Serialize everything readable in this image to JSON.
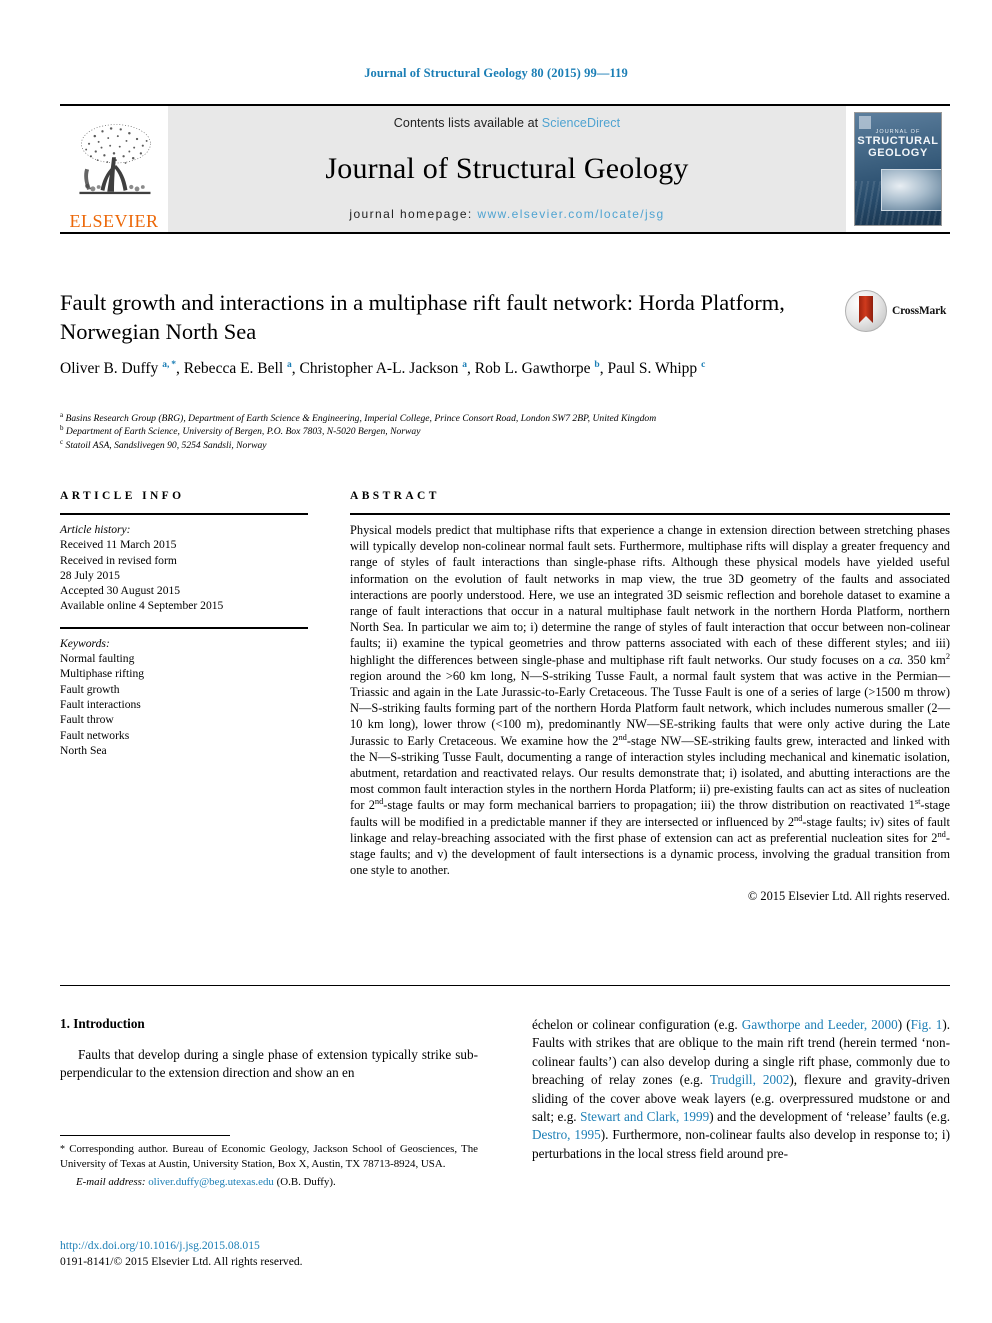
{
  "running_head": "Journal of Structural Geology 80 (2015) 99—119",
  "masthead": {
    "publisher_name": "ELSEVIER",
    "publisher_logo_icon": "elsevier-tree-icon",
    "contents_prefix": "Contents lists available at ",
    "contents_link": "ScienceDirect",
    "journal_name": "Journal of Structural Geology",
    "homepage_prefix": "journal homepage: ",
    "homepage_url": "www.elsevier.com/locate/jsg",
    "cover": {
      "line1": "JOURNAL OF",
      "line2": "STRUCTURAL",
      "line3": "GEOLOGY"
    }
  },
  "crossmark": {
    "label": "CrossMark",
    "icon": "crossmark-icon"
  },
  "title": "Fault growth and interactions in a multiphase rift fault network: Horda Platform, Norwegian North Sea",
  "authors_html": "Oliver B. Duffy <sup>a, *</sup>, Rebecca E. Bell <sup>a</sup>, Christopher A-L. Jackson <sup>a</sup>, Rob L. Gawthorpe <sup>b</sup>, Paul S. Whipp <sup>c</sup>",
  "affiliations": [
    {
      "marker": "a",
      "text": "Basins Research Group (BRG), Department of Earth Science & Engineering, Imperial College, Prince Consort Road, London SW7 2BP, United Kingdom"
    },
    {
      "marker": "b",
      "text": "Department of Earth Science, University of Bergen, P.O. Box 7803, N-5020 Bergen, Norway"
    },
    {
      "marker": "c",
      "text": "Statoil ASA, Sandslivegen 90, 5254 Sandsli, Norway"
    }
  ],
  "article_info": {
    "heading": "ARTICLE INFO",
    "history_label": "Article history:",
    "history": [
      "Received 11 March 2015",
      "Received in revised form",
      "28 July 2015",
      "Accepted 30 August 2015",
      "Available online 4 September 2015"
    ],
    "keywords_label": "Keywords:",
    "keywords": [
      "Normal faulting",
      "Multiphase rifting",
      "Fault growth",
      "Fault interactions",
      "Fault throw",
      "Fault networks",
      "North Sea"
    ]
  },
  "abstract": {
    "heading": "ABSTRACT",
    "body_html": "Physical models predict that multiphase rifts that experience a change in extension direction between stretching phases will typically develop non-colinear normal fault sets. Furthermore, multiphase rifts will display a greater frequency and range of styles of fault interactions than single-phase rifts. Although these physical models have yielded useful information on the evolution of fault networks in map view, the true 3D geometry of the faults and associated interactions are poorly understood. Here, we use an integrated 3D seismic reflection and borehole dataset to examine a range of fault interactions that occur in a natural multiphase fault network in the northern Horda Platform, northern North Sea. In particular we aim to; i) determine the range of styles of fault interaction that occur between non-colinear faults; ii) examine the typical geometries and throw patterns associated with each of these different styles; and iii) highlight the differences between single-phase and multiphase rift fault networks. Our study focuses on a <i>ca.</i> 350 km<sup>2</sup> region around the &gt;60 km long, N—S-striking Tusse Fault, a normal fault system that was active in the Permian—Triassic and again in the Late Jurassic-to-Early Cretaceous. The Tusse Fault is one of a series of large (&gt;1500 m throw) N—S-striking faults forming part of the northern Horda Platform fault network, which includes numerous smaller (2—10 km long), lower throw (&lt;100 m), predominantly NW—SE-striking faults that were only active during the Late Jurassic to Early Cretaceous. We examine how the 2<sup>nd</sup>-stage NW—SE-striking faults grew, interacted and linked with the N—S-striking Tusse Fault, documenting a range of interaction styles including mechanical and kinematic isolation, abutment, retardation and reactivated relays. Our results demonstrate that; i) isolated, and abutting interactions are the most common fault interaction styles in the northern Horda Platform; ii) pre-existing faults can act as sites of nucleation for 2<sup>nd</sup>-stage faults or may form mechanical barriers to propagation; iii) the throw distribution on reactivated 1<sup>st</sup>-stage faults will be modified in a predictable manner if they are intersected or influenced by 2<sup>nd</sup>-stage faults; iv) sites of fault linkage and relay-breaching associated with the first phase of extension can act as preferential nucleation sites for 2<sup>nd</sup>-stage faults; and v) the development of fault intersections is a dynamic process, involving the gradual transition from one style to another.",
    "copyright": "© 2015 Elsevier Ltd. All rights reserved."
  },
  "introduction": {
    "heading": "1. Introduction",
    "left_paragraph": "Faults that develop during a single phase of extension typically strike sub-perpendicular to the extension direction and show an en",
    "right_paragraph_html": "échelon or colinear configuration (e.g. <span class=\"ref\">Gawthorpe and Leeder, 2000</span>) (<span class=\"ref\">Fig. 1</span>). Faults with strikes that are oblique to the main rift trend (herein termed ‘non-colinear faults’) can also develop during a single rift phase, commonly due to breaching of relay zones (e.g. <span class=\"ref\">Trudgill, 2002</span>), flexure and gravity-driven sliding of the cover above weak layers (e.g. overpressured mudstone or and salt; e.g. <span class=\"ref\">Stewart and Clark, 1999</span>) and the development of ‘release’ faults (e.g. <span class=\"ref\">Destro, 1995</span>). Furthermore, non-colinear faults also develop in response to; i) perturbations in the local stress field around pre-"
  },
  "footnote": {
    "corresponding_html": "<span class=\"star\">*</span> Corresponding author. Bureau of Economic Geology, Jackson School of Geosciences, The University of Texas at Austin, University Station, Box X, Austin, TX 78713-8924, USA.",
    "email_label": "E-mail address:",
    "email": "oliver.duffy@beg.utexas.edu",
    "email_suffix": "(O.B. Duffy)."
  },
  "doi": {
    "url": "http://dx.doi.org/10.1016/j.jsg.2015.08.015",
    "issn_line": "0191-8141/© 2015 Elsevier Ltd. All rights reserved."
  },
  "colors": {
    "link_blue": "#1b7eb5",
    "header_blue": "#4fa3d1",
    "elsevier_orange": "#ec6707",
    "masthead_grey": "#e8e8e8"
  }
}
